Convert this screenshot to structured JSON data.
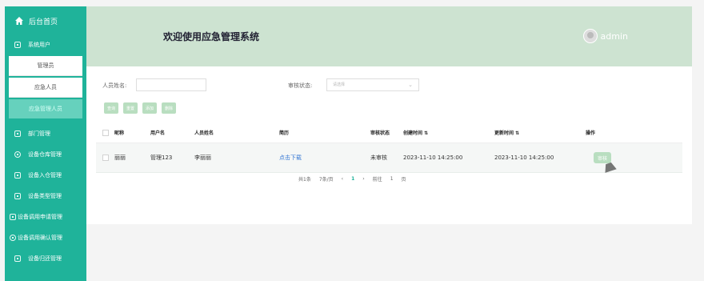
{
  "sidebar": {
    "home": "后台首页",
    "system_users": "系统用户",
    "sub_items": [
      "管理员",
      "应急人员",
      "应急管理人员"
    ],
    "items": [
      "部门管理",
      "设备仓库管理",
      "设备入仓管理",
      "设备类型管理",
      "设备调用申请管理",
      "设备调用确认管理",
      "设备归还管理"
    ]
  },
  "header": {
    "title": "欢迎使用应急管理系统",
    "user": "admin"
  },
  "search": {
    "name_label": "人员姓名:",
    "status_label": "审核状态:",
    "status_placeholder": "请选择"
  },
  "actions": {
    "query": "查询",
    "reset": "重置",
    "add": "添加",
    "delete": "删除"
  },
  "table": {
    "headers": [
      "昵称",
      "用户名",
      "人员姓名",
      "简历",
      "审核状态",
      "创建时间 ⇅",
      "更新时间 ⇅",
      "操作"
    ],
    "rows": [
      {
        "nickname": "丽丽",
        "username": "管理123",
        "person_name": "李丽丽",
        "resume": "点击下载",
        "status": "未审核",
        "created": "2023-11-10 14:25:00",
        "updated": "2023-11-10 14:25:00",
        "operation": "审核"
      }
    ]
  },
  "pagination": {
    "total": "共1条",
    "page_size": "7条/页",
    "current": "1",
    "goto": "前往",
    "goto_value": "1",
    "page": "页"
  },
  "colors": {
    "sidebar": "#1fb39a",
    "header": "#cde3d1",
    "active": "#66d1bd"
  },
  "icons": {
    "home": "home-icon",
    "avatar": "avatar-icon"
  }
}
